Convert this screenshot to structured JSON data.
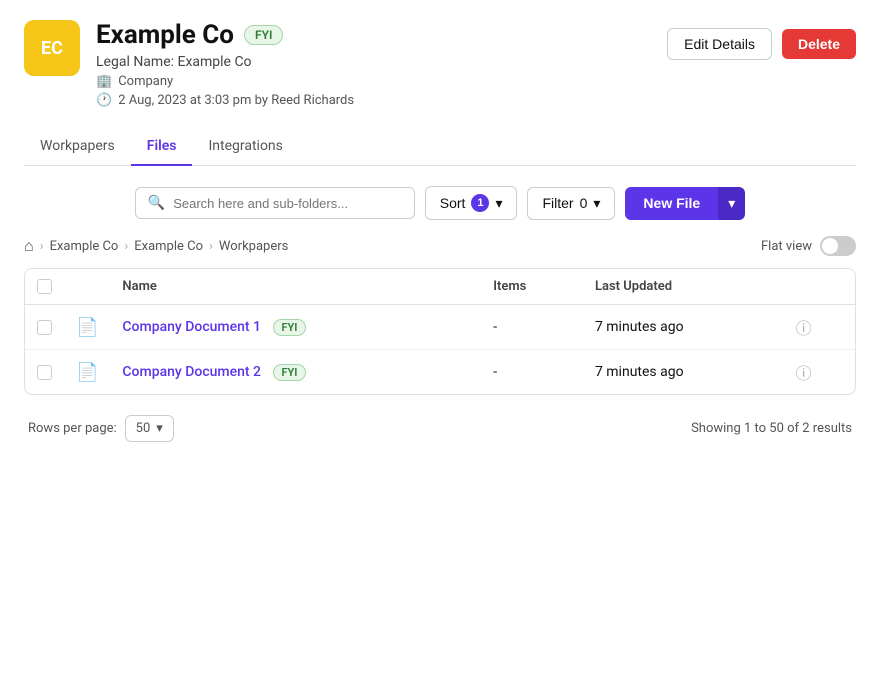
{
  "header": {
    "avatar_text": "EC",
    "company_name": "Example Co",
    "badge": "FYI",
    "legal_name": "Legal Name: Example Co",
    "type_icon": "🏢",
    "type_label": "Company",
    "clock_icon": "🕐",
    "timestamp": "2 Aug, 2023 at 3:03 pm by Reed Richards",
    "edit_button": "Edit Details",
    "delete_button": "Delete"
  },
  "tabs": [
    {
      "label": "Workpapers",
      "active": false
    },
    {
      "label": "Files",
      "active": true
    },
    {
      "label": "Integrations",
      "active": false
    }
  ],
  "toolbar": {
    "search_placeholder": "Search here and sub-folders...",
    "sort_label": "Sort",
    "sort_count": "1",
    "filter_label": "Filter",
    "filter_count": "0",
    "new_file_label": "New File"
  },
  "breadcrumb": {
    "home_icon": "⌂",
    "items": [
      "Example Co",
      "Example Co",
      "Workpapers"
    ]
  },
  "flat_view_label": "Flat view",
  "table": {
    "columns": [
      "Name",
      "Items",
      "Last Updated"
    ],
    "rows": [
      {
        "name": "Company Document 1",
        "badge": "FYI",
        "items": "-",
        "last_updated": "7 minutes ago"
      },
      {
        "name": "Company Document 2",
        "badge": "FYI",
        "items": "-",
        "last_updated": "7 minutes ago"
      }
    ]
  },
  "pagination": {
    "rows_per_page_label": "Rows per page:",
    "rows_per_page_value": "50",
    "showing_text": "Showing 1 to 50 of 2 results"
  }
}
